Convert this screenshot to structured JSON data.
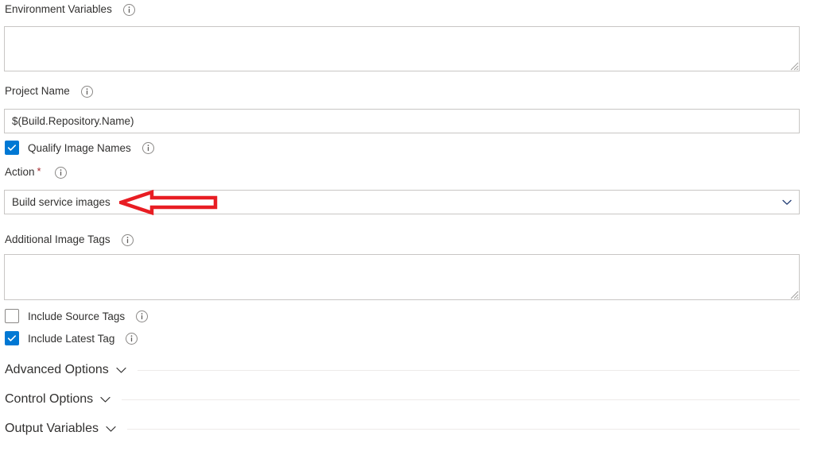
{
  "form": {
    "environment_variables": {
      "label": "Environment Variables",
      "value": "",
      "info_icon": "info-icon"
    },
    "project_name": {
      "label": "Project Name",
      "value": "$(Build.Repository.Name)",
      "info_icon": "info-icon"
    },
    "qualify_image_names": {
      "label": "Qualify Image Names",
      "checked": true,
      "info_icon": "info-icon"
    },
    "action": {
      "label": "Action",
      "required_marker": "*",
      "value": "Build service images",
      "chevron_icon": "chevron-down-icon",
      "info_icon": "info-icon"
    },
    "additional_image_tags": {
      "label": "Additional Image Tags",
      "value": "",
      "info_icon": "info-icon"
    },
    "include_source_tags": {
      "label": "Include Source Tags",
      "checked": false,
      "info_icon": "info-icon"
    },
    "include_latest_tag": {
      "label": "Include Latest Tag",
      "checked": true,
      "info_icon": "info-icon"
    }
  },
  "sections": [
    {
      "title": "Advanced Options",
      "chevron_icon": "chevron-down-icon",
      "expanded": false
    },
    {
      "title": "Control Options",
      "chevron_icon": "chevron-down-icon",
      "expanded": false
    },
    {
      "title": "Output Variables",
      "chevron_icon": "chevron-down-icon",
      "expanded": false
    }
  ],
  "annotation": {
    "type": "arrow",
    "direction": "left",
    "color": "#e81d23",
    "fill": "#ffffff",
    "points_at": "Build service images"
  },
  "colors": {
    "accent": "#0078d4",
    "text": "#323130",
    "border": "#c8c6c4",
    "rule": "#edebe9",
    "required": "#a4262c",
    "annotation": "#e81d23"
  }
}
